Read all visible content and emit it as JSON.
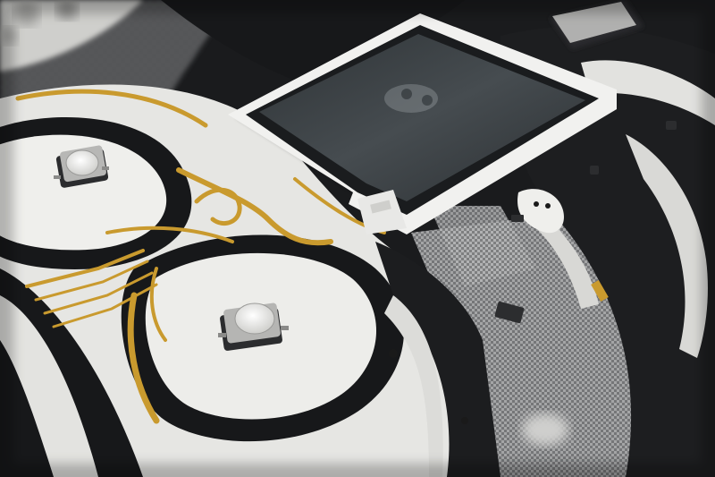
{
  "scene": {
    "kind": "photo",
    "colors": {
      "background": "#1a1a1c",
      "board_white": "#e9e9e6",
      "board_black": "#17181a",
      "trace_gold": "#c99a2e",
      "mesh_gray": "#8e8f91",
      "screen_glass": "#3b4043",
      "screen_frame": "#f1f1ef"
    },
    "icons": [
      "push-button-icon",
      "display-screen-icon",
      "sd-card-icon",
      "smd-component-icon"
    ]
  }
}
